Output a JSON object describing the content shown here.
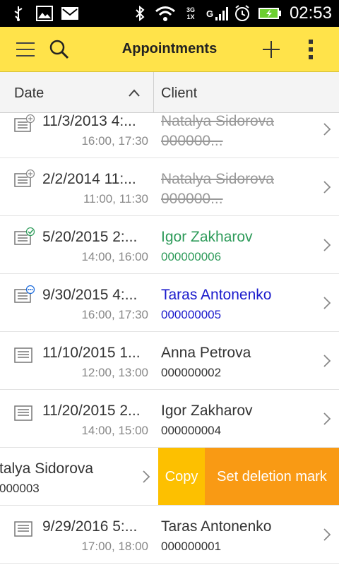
{
  "status_bar": {
    "time": "02:53",
    "network_label": "3G",
    "network_sub": "1X",
    "g_label": "G"
  },
  "toolbar": {
    "title": "Appointments",
    "menu_icon": "hamburger-icon",
    "search_icon": "search-icon",
    "add_icon": "plus-icon",
    "more_icon": "kebab-icon"
  },
  "header": {
    "date_label": "Date",
    "client_label": "Client",
    "sort": "ascending"
  },
  "rows": [
    {
      "date": "11/3/2013 4:...",
      "time": "16:00, 17:30",
      "client": "Natalya Sidorova",
      "number": "000000...",
      "status": "deleted",
      "icon": "document-add-icon"
    },
    {
      "date": "2/2/2014 11:...",
      "time": "11:00, 11:30",
      "client": "Natalya Sidorova",
      "number": "000000...",
      "status": "deleted",
      "icon": "document-add-icon"
    },
    {
      "date": "5/20/2015 2:...",
      "time": "14:00, 16:00",
      "client": "Igor Zakharov",
      "number": "000000006",
      "status": "completed",
      "icon": "document-check-icon"
    },
    {
      "date": "9/30/2015 4:...",
      "time": "16:00, 17:30",
      "client": "Taras Antonenko",
      "number": "000000005",
      "status": "in-progress",
      "icon": "document-dots-icon"
    },
    {
      "date": "11/10/2015 1...",
      "time": "12:00, 13:00",
      "client": "Anna Petrova",
      "number": "000000002",
      "status": "normal",
      "icon": "document-icon"
    },
    {
      "date": "11/20/2015 2...",
      "time": "14:00, 15:00",
      "client": "Igor Zakharov",
      "number": "000000004",
      "status": "normal",
      "icon": "document-icon"
    }
  ],
  "swiped_row": {
    "client": "talya Sidorova",
    "number": "000003",
    "copy_label": "Copy",
    "delete_label": "Set deletion mark"
  },
  "last_row": {
    "date": "9/29/2016 5:...",
    "time": "17:00, 18:00",
    "client": "Taras Antonenko",
    "number": "000000001",
    "icon": "document-icon"
  },
  "colors": {
    "toolbar": "#ffe34a",
    "copy": "#fdc000",
    "deletion": "#f99a14",
    "completed": "#2e9b5a",
    "in_progress": "#1a1acc"
  }
}
